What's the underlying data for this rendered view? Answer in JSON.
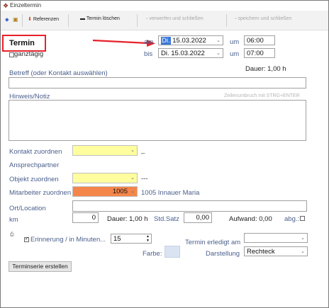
{
  "window": {
    "title": "Einzeltermin"
  },
  "toolbar": {
    "referenzen": "Referenzen",
    "termin_loeschen": "Termin löschen",
    "verwerfen": "verwerfen und schließen",
    "speichern": "speichern und schließen"
  },
  "form": {
    "heading": "Termin",
    "ganztaegig": "ganztägig",
    "am_label": "am",
    "bis_label": "bis",
    "um_label": "um",
    "day_prefix": "Di.",
    "start_date_rest": "15.03.2022",
    "end_date": "Di. 15.03.2022",
    "start_time": "06:00",
    "end_time": "07:00",
    "dauer_text": "Dauer: 1,00 h",
    "betreff_label": "Betreff (oder Kontakt auswählen)",
    "betreff_value": "",
    "hinweis_label": "Hinweis/Notiz",
    "hinweis_hint": "Zeilenumbruch mit STRG+ENTER",
    "hinweis_value": "",
    "kontakt_label": "Kontakt zuordnen",
    "kontakt_suffix": "_",
    "ansprechpartner_label": "Ansprechpartner",
    "objekt_label": "Objekt zuordnen",
    "objekt_suffix": "---",
    "mitarbeiter_label": "Mitarbeiter zuordnen",
    "mitarbeiter_value": "1005",
    "mitarbeiter_name": "1005 Innauer Maria",
    "ort_label": "Ort/Location",
    "km_label": "km",
    "km_value": "0",
    "dauer2": "Dauer: 1,00 h",
    "stdsatz_label": "Std.Satz",
    "stdsatz_value": "0,00",
    "aufwand": "Aufwand: 0,00",
    "abg_label": "abg.:",
    "erinnerung_label": "Erinnerung / in Minuten...",
    "erinnerung_value": "15",
    "erledigt_label": "Termin erledigt am",
    "farbe_label": "Farbe:",
    "darstellung_label": "Darstellung",
    "darstellung_value": "Rechteck",
    "terminserie_button": "Terminserie erstellen"
  },
  "colors": {
    "highlight": "#e8212a",
    "kontakt_fill": "#fefe9e",
    "mitarbeiter_fill": "#f5864b",
    "farbe_swatch": "#d9e3f2"
  }
}
